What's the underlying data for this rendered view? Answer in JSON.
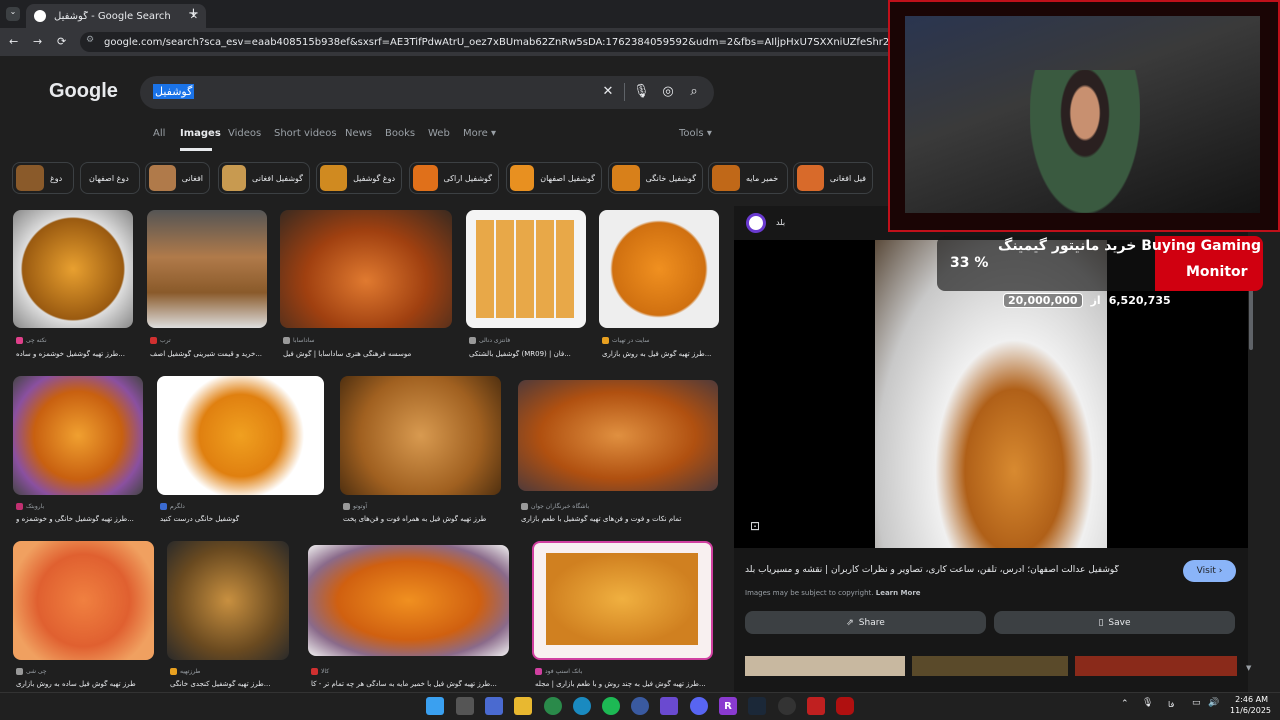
{
  "browser": {
    "tab_title": "گوشفیل - Google Search",
    "url": "google.com/search?sca_esv=eaab408515b938ef&sxsrf=AE3TifPdwAtrU_oez7xBUmab62ZnRw5sDA:1762384059592&udm=2&fbs=AIljpHxU7SXXniUZfeShr2fp4giZ1Y6MJ25_tmWITc7uy4KIeoJT"
  },
  "google": {
    "logo": "Google",
    "query": "گوشفیل",
    "tabs": [
      "All",
      "Images",
      "Videos",
      "Short videos",
      "News",
      "Books",
      "Web",
      "More ▾"
    ],
    "tools": "Tools ▾"
  },
  "chips": [
    "دوغ",
    "دوغ اصفهان",
    "افغانی",
    "گوشفیل افغانی",
    "دوغ گوشفیل",
    "گوشفیل اراکی",
    "گوشفیل اصفهان",
    "گوشفیل خانگی",
    "خمیر مایه",
    "فیل افغانی"
  ],
  "results": [
    {
      "source": "نکته چی",
      "caption": "طرز تهیه گوشفیل خوشمزه و ساده..."
    },
    {
      "source": "ترب",
      "caption": "خرید و قیمت شیرینی گوشفیل اصف..."
    },
    {
      "source": "ساداسابا",
      "caption": "موسسه فرهنگی هنری ساداسابا | گوش فیل"
    },
    {
      "source": "فانتزی دنالی",
      "caption": "گوشفیل بالشتکی (MR09) | فان..."
    },
    {
      "source": "سایت در تهیات",
      "caption": "طرز تهیه گوش فیل به روش بازاری..."
    },
    {
      "source": "باروبتک",
      "caption": "طرز تهیه گوشفیل خانگی و خوشمزه و..."
    },
    {
      "source": "دلگرم",
      "caption": "گوشفیل خانگی درست کنید"
    },
    {
      "source": "آوتوتو",
      "caption": "طرز تهیه گوش فیل به همراه فوت و فن‌های پخت"
    },
    {
      "source": "باشگاه خبرنگاران جوان",
      "caption": "تمام نکات و فوت و فن‌های تهیه گوشفیل با طعم بازاری"
    },
    {
      "source": "چی شی",
      "caption": "طرز تهیه گوش فیل ساده به روش بازاری"
    },
    {
      "source": "طرزتهیه",
      "caption": "طرز تهیه گوشفیل کنجدی خانگی..."
    },
    {
      "source": "کالا",
      "caption": "طرز تهیه گوش فیل با خمیر مایه به سادگی هر چه تمام تر - کا..."
    },
    {
      "source": "بانک اسنپ فود",
      "caption": "طرز تهیه گوش فیل به چند روش و با طعم بازاری | مجله..."
    }
  ],
  "panel": {
    "site": "بلد",
    "title": "گوشفیل عدالت اصفهان؛ آدرس، تلفن، ساعت کاری، تصاویر و نظرات کاربران | نقشه و مسیریاب بلد",
    "visit": "Visit ›",
    "notice": "Images may be subject to copyright.",
    "learn_more": "Learn More",
    "share": "Share",
    "save": "Save"
  },
  "ad_overlay": {
    "title_line1": "خرید مانیتور گیمینگ Buying Gaming",
    "title_line2": "Monitor",
    "discount": "33 %",
    "old_price": "20,000,000",
    "from": "از",
    "new_price": "6,520,735"
  },
  "taskbar": {
    "lang": "فا",
    "time": "2:46 AM",
    "date": "11/6/2025"
  },
  "colors": {
    "accent": "#8ab4f8",
    "selection": "#1a73e8",
    "overlay_red": "#d00010"
  }
}
